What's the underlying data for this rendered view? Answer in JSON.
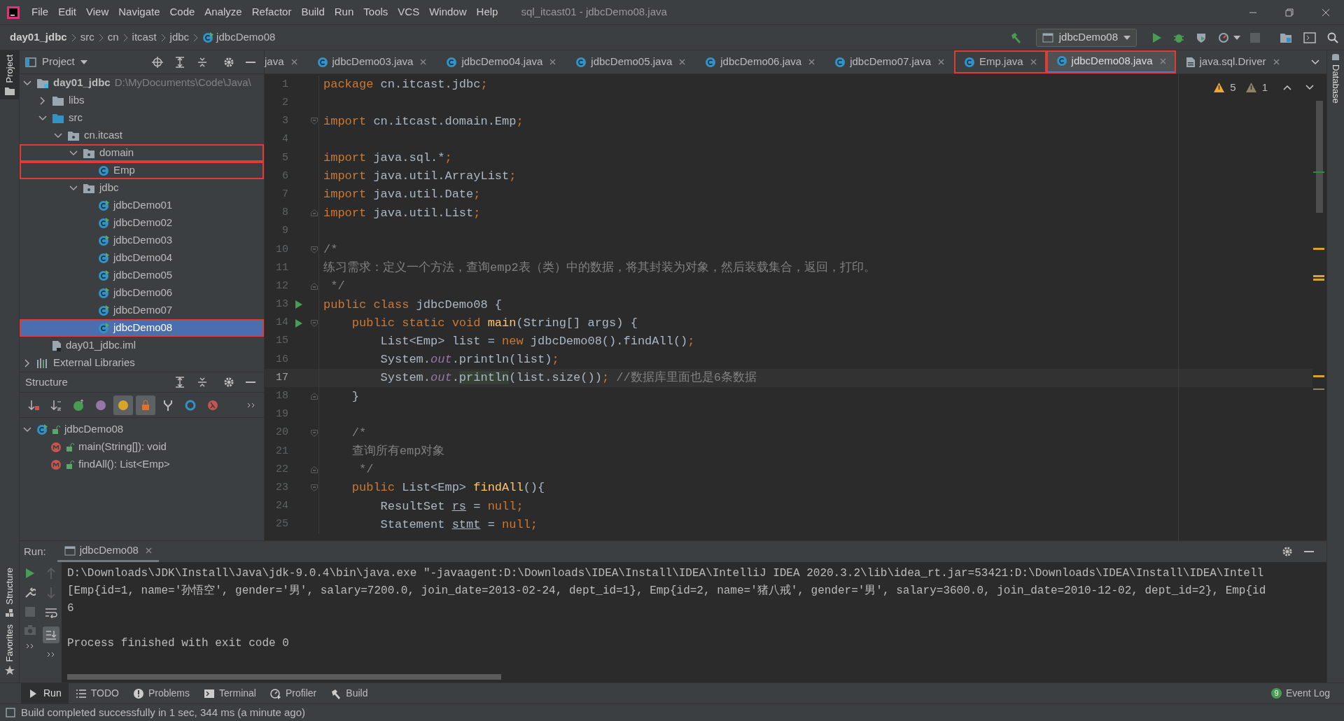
{
  "window": {
    "title": "sql_itcast01 - jdbcDemo08.java"
  },
  "menu": [
    "File",
    "Edit",
    "View",
    "Navigate",
    "Code",
    "Analyze",
    "Refactor",
    "Build",
    "Run",
    "Tools",
    "VCS",
    "Window",
    "Help"
  ],
  "breadcrumbs": [
    "day01_jdbc",
    "src",
    "cn",
    "itcast",
    "jdbc",
    "jdbcDemo08"
  ],
  "run_config": "jdbcDemo08",
  "side_left": {
    "top": "Project",
    "bottom": [
      "Structure",
      "Favorites"
    ]
  },
  "side_right": "Database",
  "project": {
    "title": "Project",
    "tree": [
      {
        "label": "day01_jdbc",
        "path": "D:\\MyDocuments\\Code\\Java\\",
        "kind": "module",
        "expanded": true,
        "selected": false,
        "highlighted": false,
        "children": [
          {
            "label": "libs",
            "kind": "folder",
            "expanded": false,
            "selected": false,
            "highlighted": false
          },
          {
            "label": "src",
            "kind": "source",
            "expanded": true,
            "selected": false,
            "highlighted": false,
            "children": [
              {
                "label": "cn.itcast",
                "kind": "package",
                "expanded": true,
                "selected": false,
                "highlighted": false,
                "children": [
                  {
                    "label": "domain",
                    "kind": "package",
                    "expanded": true,
                    "selected": false,
                    "highlighted": true,
                    "children": [
                      {
                        "label": "Emp",
                        "kind": "class",
                        "selected": false,
                        "highlighted": true
                      }
                    ]
                  },
                  {
                    "label": "jdbc",
                    "kind": "package",
                    "expanded": true,
                    "selected": false,
                    "highlighted": false,
                    "children": [
                      {
                        "label": "jdbcDemo01",
                        "kind": "runnable",
                        "selected": false,
                        "highlighted": false
                      },
                      {
                        "label": "jdbcDemo02",
                        "kind": "runnable",
                        "selected": false,
                        "highlighted": false
                      },
                      {
                        "label": "jdbcDemo03",
                        "kind": "runnable",
                        "selected": false,
                        "highlighted": false
                      },
                      {
                        "label": "jdbcDemo04",
                        "kind": "runnable",
                        "selected": false,
                        "highlighted": false
                      },
                      {
                        "label": "jdbcDemo05",
                        "kind": "runnable",
                        "selected": false,
                        "highlighted": false
                      },
                      {
                        "label": "jdbcDemo06",
                        "kind": "runnable",
                        "selected": false,
                        "highlighted": false
                      },
                      {
                        "label": "jdbcDemo07",
                        "kind": "runnable",
                        "selected": false,
                        "highlighted": false
                      },
                      {
                        "label": "jdbcDemo08",
                        "kind": "runnable",
                        "selected": true,
                        "highlighted": true
                      }
                    ]
                  }
                ]
              }
            ]
          },
          {
            "label": "day01_jdbc.iml",
            "kind": "file",
            "selected": false,
            "highlighted": false
          }
        ]
      },
      {
        "label": "External Libraries",
        "kind": "library",
        "expanded": false,
        "selected": false,
        "highlighted": false
      }
    ]
  },
  "structure": {
    "title": "Structure",
    "toolbar": [
      {
        "on": false
      },
      {
        "on": false
      },
      {
        "on": false
      },
      {
        "on": false
      },
      {
        "on": true
      },
      {
        "on": true
      },
      {
        "on": false
      },
      {
        "on": false
      },
      {
        "on": false
      }
    ],
    "tree": [
      {
        "label": "jdbcDemo08",
        "kind": "runnable",
        "expanded": true,
        "children": [
          {
            "label": "main(String[]): void",
            "kind": "method"
          },
          {
            "label": "findAll(): List<Emp>",
            "kind": "method"
          }
        ]
      }
    ]
  },
  "tabs": [
    {
      "label": "java",
      "kind": "partial",
      "selected": false,
      "highlighted": false
    },
    {
      "label": "jdbcDemo03.java",
      "kind": "class",
      "selected": false,
      "highlighted": false
    },
    {
      "label": "jdbcDemo04.java",
      "kind": "class",
      "selected": false,
      "highlighted": false
    },
    {
      "label": "jdbcDemo05.java",
      "kind": "class",
      "selected": false,
      "highlighted": false
    },
    {
      "label": "jdbcDemo06.java",
      "kind": "class",
      "selected": false,
      "highlighted": false
    },
    {
      "label": "jdbcDemo07.java",
      "kind": "class",
      "selected": false,
      "highlighted": false
    },
    {
      "label": "Emp.java",
      "kind": "class",
      "selected": false,
      "highlighted": true
    },
    {
      "label": "jdbcDemo08.java",
      "kind": "class",
      "selected": true,
      "highlighted": true
    },
    {
      "label": "java.sql.Driver",
      "kind": "library",
      "selected": false,
      "highlighted": false
    }
  ],
  "inspections": {
    "warnings": "5",
    "weak_warnings": "1"
  },
  "code": [
    {
      "n": "1",
      "run": false,
      "current": false,
      "fold_start": false,
      "fold_end": false,
      "tokens": [
        {
          "t": "package",
          "kind": "kw"
        },
        {
          "t": " cn.itcast.jdbc",
          "kind": "plain"
        },
        {
          "t": ";",
          "kind": "kw"
        }
      ]
    },
    {
      "n": "2",
      "run": false,
      "current": false,
      "fold_start": false,
      "fold_end": false
    },
    {
      "n": "3",
      "run": false,
      "current": false,
      "fold_start": true,
      "fold_end": false,
      "tokens": [
        {
          "t": "import",
          "kind": "kw"
        },
        {
          "t": " cn.itcast.domain.Emp",
          "kind": "plain"
        },
        {
          "t": ";",
          "kind": "kw"
        }
      ]
    },
    {
      "n": "4",
      "run": false,
      "current": false,
      "fold_start": false,
      "fold_end": false
    },
    {
      "n": "5",
      "run": false,
      "current": false,
      "fold_start": false,
      "fold_end": false,
      "tokens": [
        {
          "t": "import",
          "kind": "kw"
        },
        {
          "t": " java.sql.*",
          "kind": "plain"
        },
        {
          "t": ";",
          "kind": "kw"
        }
      ]
    },
    {
      "n": "6",
      "run": false,
      "current": false,
      "fold_start": false,
      "fold_end": false,
      "tokens": [
        {
          "t": "import",
          "kind": "kw"
        },
        {
          "t": " java.util.ArrayList",
          "kind": "plain"
        },
        {
          "t": ";",
          "kind": "kw"
        }
      ]
    },
    {
      "n": "7",
      "run": false,
      "current": false,
      "fold_start": false,
      "fold_end": false,
      "tokens": [
        {
          "t": "import",
          "kind": "kw"
        },
        {
          "t": " java.util.Date",
          "kind": "plain"
        },
        {
          "t": ";",
          "kind": "kw"
        }
      ]
    },
    {
      "n": "8",
      "run": false,
      "current": false,
      "fold_start": false,
      "fold_end": true,
      "tokens": [
        {
          "t": "import",
          "kind": "kw"
        },
        {
          "t": " java.util.List",
          "kind": "plain"
        },
        {
          "t": ";",
          "kind": "kw"
        }
      ]
    },
    {
      "n": "9",
      "run": false,
      "current": false,
      "fold_start": false,
      "fold_end": false
    },
    {
      "n": "10",
      "run": false,
      "current": false,
      "fold_start": true,
      "fold_end": false,
      "tokens": [
        {
          "t": "/*",
          "kind": "comment"
        }
      ]
    },
    {
      "n": "11",
      "run": false,
      "current": false,
      "fold_start": false,
      "fold_end": false,
      "tokens": [
        {
          "t": "练习需求：定义一个方法，查询emp2表（类）中的数据，将其封装为对象，然后装载集合，返回，打印。",
          "kind": "comment"
        }
      ]
    },
    {
      "n": "12",
      "run": false,
      "current": false,
      "fold_start": false,
      "fold_end": true,
      "tokens": [
        {
          "t": " */",
          "kind": "comment"
        }
      ]
    },
    {
      "n": "13",
      "run": true,
      "current": false,
      "fold_start": false,
      "fold_end": false,
      "tokens": [
        {
          "t": "public class",
          "kind": "kw"
        },
        {
          "t": " jdbcDemo08 {",
          "kind": "plain"
        }
      ]
    },
    {
      "n": "14",
      "run": true,
      "current": false,
      "fold_start": true,
      "fold_end": false,
      "tokens": [
        {
          "t": "    public static void",
          "kind": "kw"
        },
        {
          "t": " main",
          "kind": "fn"
        },
        {
          "t": "(String[] args) {",
          "kind": "plain"
        }
      ]
    },
    {
      "n": "15",
      "run": false,
      "current": false,
      "fold_start": false,
      "fold_end": false,
      "tokens": [
        {
          "t": "        List<Emp> list = ",
          "kind": "plain"
        },
        {
          "t": "new",
          "kind": "kw"
        },
        {
          "t": " jdbcDemo08().findAll()",
          "kind": "plain"
        },
        {
          "t": ";",
          "kind": "kw"
        }
      ]
    },
    {
      "n": "16",
      "run": false,
      "current": false,
      "fold_start": false,
      "fold_end": false,
      "tokens": [
        {
          "t": "        System.",
          "kind": "plain"
        },
        {
          "t": "out",
          "kind": "static"
        },
        {
          "t": ".println(list)",
          "kind": "plain"
        },
        {
          "t": ";",
          "kind": "kw"
        }
      ]
    },
    {
      "n": "17",
      "run": false,
      "current": true,
      "fold_start": false,
      "fold_end": false,
      "tokens": [
        {
          "t": "        System.",
          "kind": "plain"
        },
        {
          "t": "out",
          "kind": "static"
        },
        {
          "t": ".",
          "kind": "plain"
        },
        {
          "t": "println",
          "kind": "match"
        },
        {
          "t": "(list.size())",
          "kind": "plain"
        },
        {
          "t": ";",
          "kind": "kw"
        },
        {
          "t": " //数据库里面也是6条数据",
          "kind": "comment"
        }
      ]
    },
    {
      "n": "18",
      "run": false,
      "current": false,
      "fold_start": false,
      "fold_end": true,
      "tokens": [
        {
          "t": "    }",
          "kind": "plain"
        }
      ]
    },
    {
      "n": "19",
      "run": false,
      "current": false,
      "fold_start": false,
      "fold_end": false
    },
    {
      "n": "20",
      "run": false,
      "current": false,
      "fold_start": true,
      "fold_end": false,
      "tokens": [
        {
          "t": "    /*",
          "kind": "comment"
        }
      ]
    },
    {
      "n": "21",
      "run": false,
      "current": false,
      "fold_start": false,
      "fold_end": false,
      "tokens": [
        {
          "t": "    查询所有emp对象",
          "kind": "comment"
        }
      ]
    },
    {
      "n": "22",
      "run": false,
      "current": false,
      "fold_start": false,
      "fold_end": true,
      "tokens": [
        {
          "t": "     */",
          "kind": "comment"
        }
      ]
    },
    {
      "n": "23",
      "run": false,
      "current": false,
      "fold_start": true,
      "fold_end": false,
      "tokens": [
        {
          "t": "    public",
          "kind": "kw"
        },
        {
          "t": " List<Emp> ",
          "kind": "plain"
        },
        {
          "t": "findAll",
          "kind": "fn"
        },
        {
          "t": "(){",
          "kind": "plain"
        }
      ]
    },
    {
      "n": "24",
      "run": false,
      "current": false,
      "fold_start": false,
      "fold_end": false,
      "tokens": [
        {
          "t": "        ResultSet ",
          "kind": "plain"
        },
        {
          "t": "rs",
          "kind": "var"
        },
        {
          "t": " = ",
          "kind": "plain"
        },
        {
          "t": "null;",
          "kind": "kw"
        }
      ]
    },
    {
      "n": "25",
      "run": false,
      "current": false,
      "fold_start": false,
      "fold_end": false,
      "tokens": [
        {
          "t": "        Statement ",
          "kind": "plain"
        },
        {
          "t": "stmt",
          "kind": "var"
        },
        {
          "t": " = ",
          "kind": "plain"
        },
        {
          "t": "null;",
          "kind": "kw"
        }
      ]
    }
  ],
  "run_panel": {
    "label": "Run:",
    "tab": "jdbcDemo08",
    "scroll_to_end": true,
    "output": [
      {
        "text": "D:\\Downloads\\JDK\\Install\\Java\\jdk-9.0.4\\bin\\java.exe \"-javaagent:D:\\Downloads\\IDEA\\Install\\IDEA\\IntelliJ IDEA 2020.3.2\\lib\\idea_rt.jar=53421:D:\\Downloads\\IDEA\\Install\\IDEA\\Intell",
        "kind": "command"
      },
      {
        "text": "[Emp{id=1, name='孙悟空', gender='男', salary=7200.0, join_date=2013-02-24, dept_id=1}, Emp{id=2, name='猪八戒', gender='男', salary=3600.0, join_date=2010-12-02, dept_id=2}, Emp{id",
        "kind": "stdout"
      },
      {
        "text": "6",
        "kind": "stdout"
      },
      {
        "text": "Process finished with exit code 0",
        "kind": "exit"
      }
    ]
  },
  "tool_tabs": [
    {
      "label": "Run",
      "selected": true
    },
    {
      "label": "TODO",
      "selected": false
    },
    {
      "label": "Problems",
      "selected": false
    },
    {
      "label": "Terminal",
      "selected": false
    },
    {
      "label": "Profiler",
      "selected": false
    },
    {
      "label": "Build",
      "selected": false
    }
  ],
  "event_log": {
    "label": "Event Log",
    "count": "9"
  },
  "status_bar": "Build completed successfully in 1 sec, 344 ms (a minute ago)"
}
